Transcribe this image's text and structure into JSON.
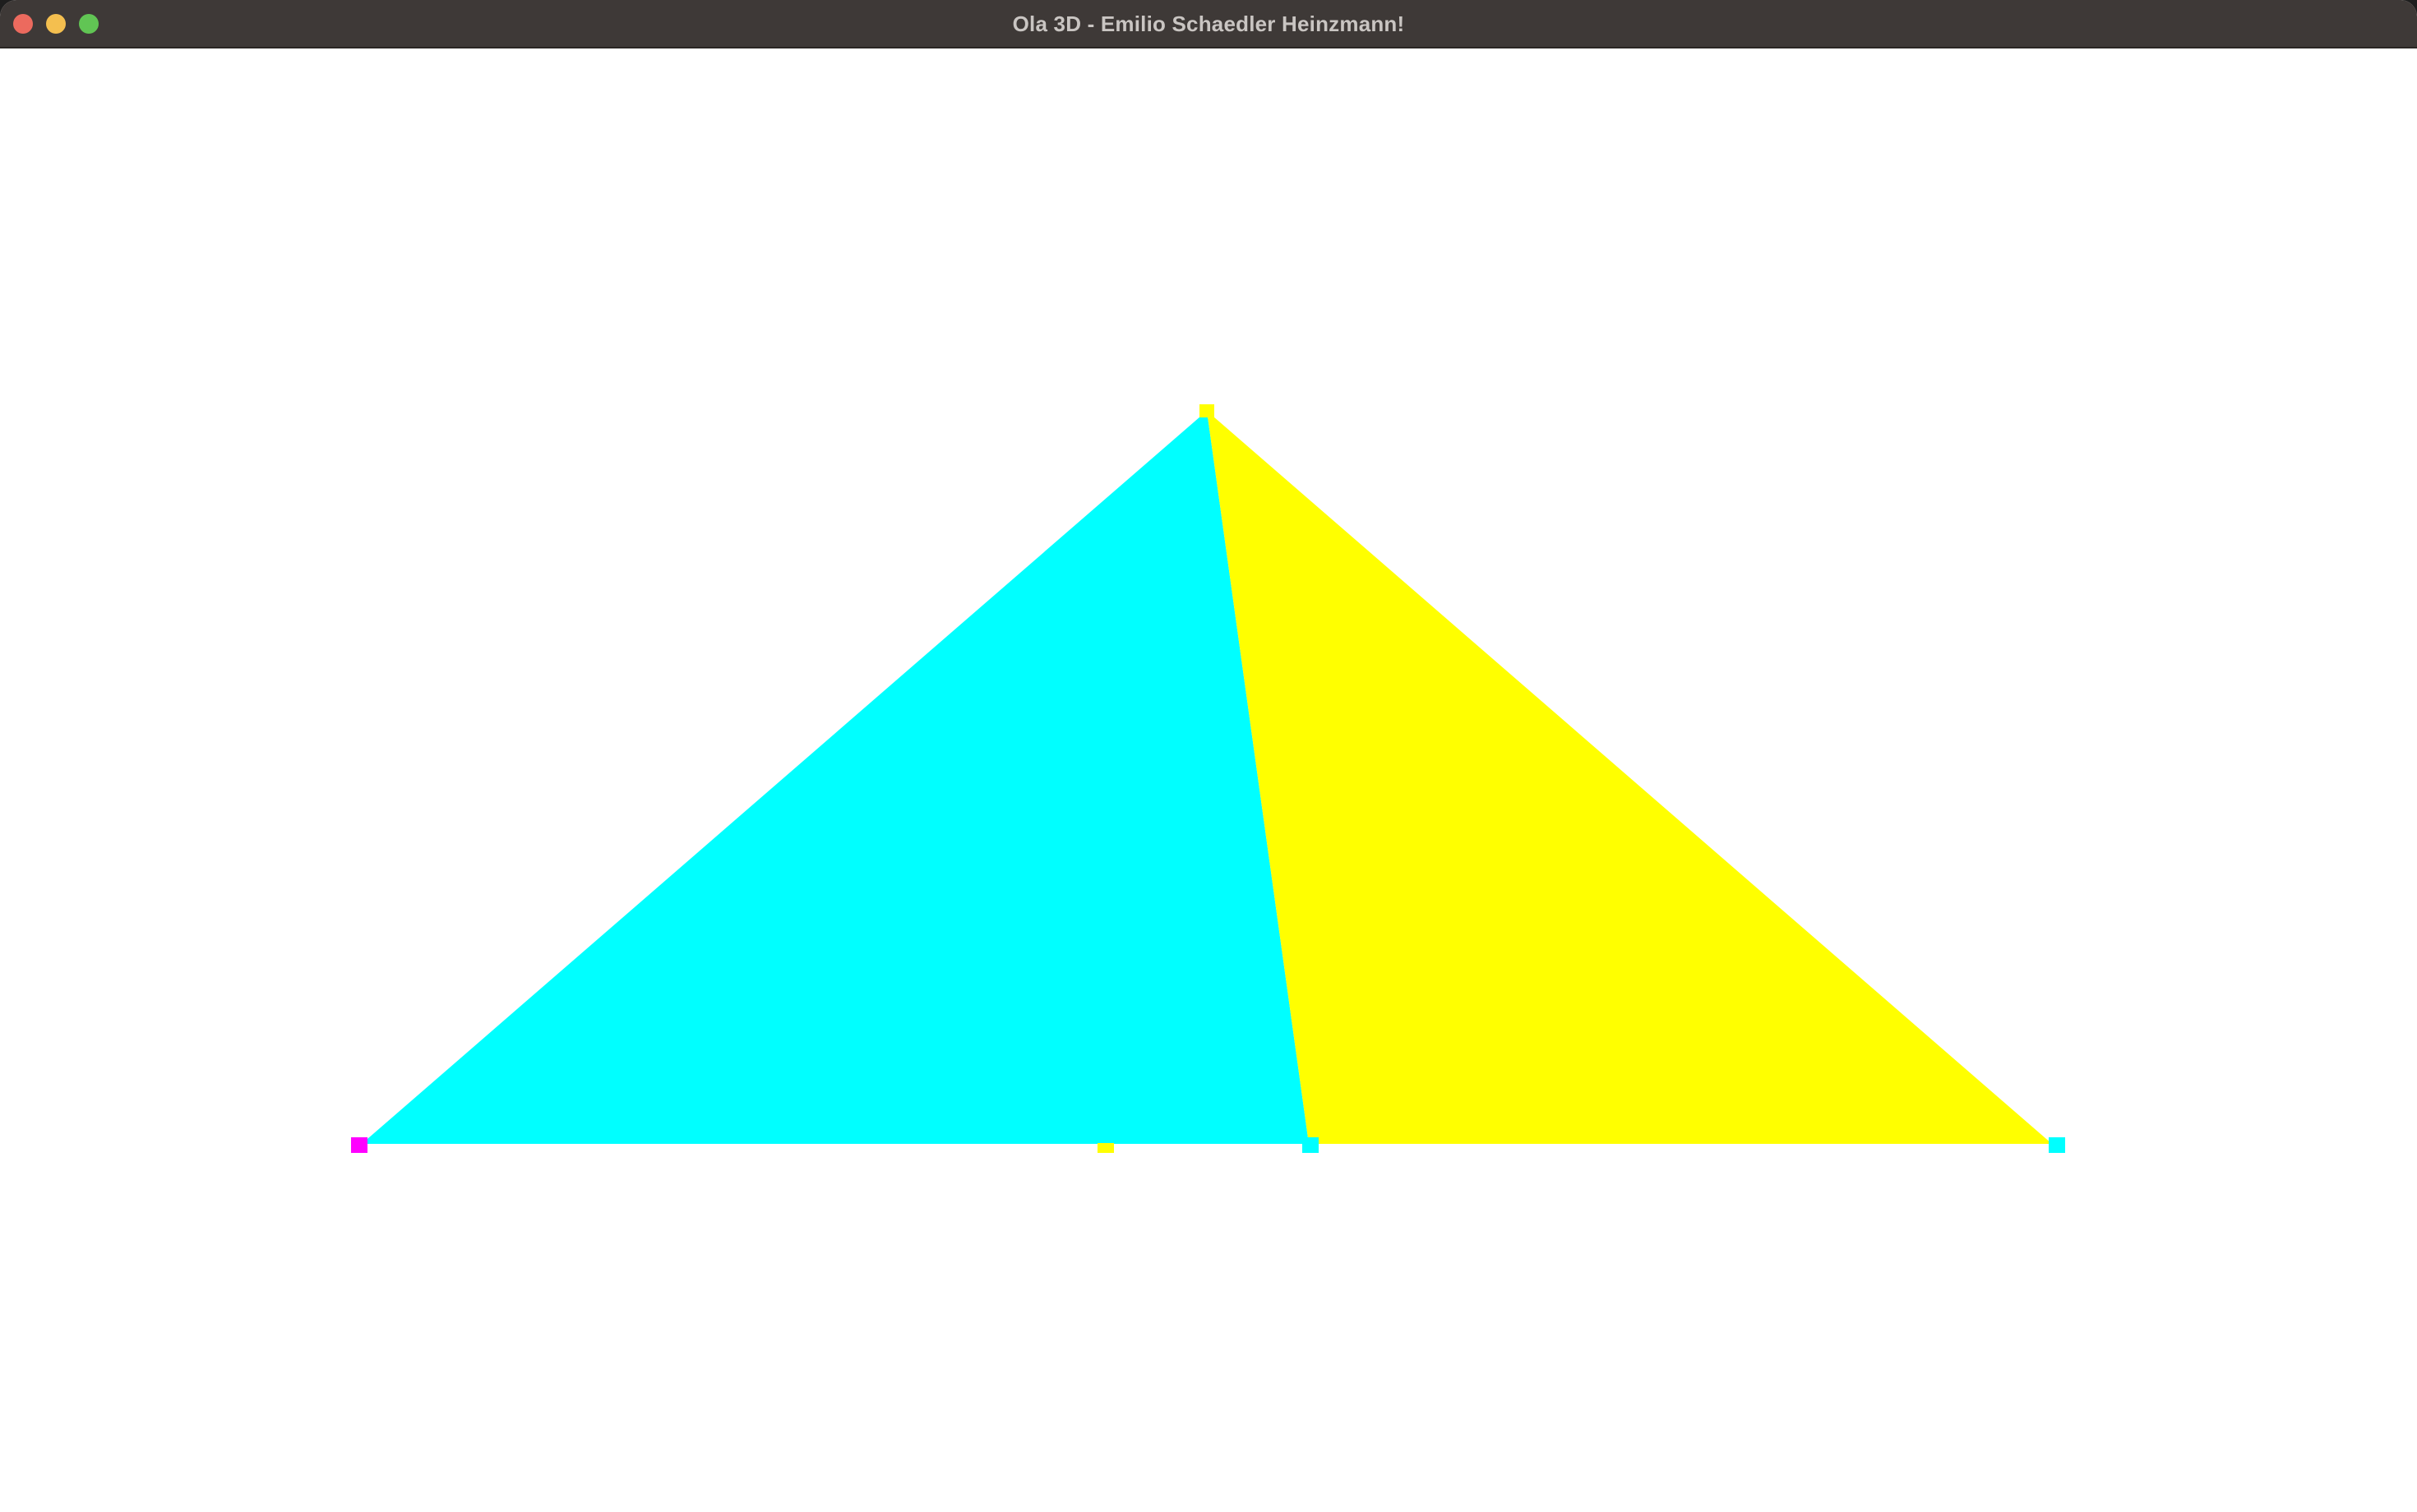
{
  "window": {
    "title": "Ola 3D - Emilio Schaedler Heinzmann!",
    "controls": {
      "close_color": "#ec6a5e",
      "minimize_color": "#f4bf4f",
      "zoom_color": "#61c554"
    }
  },
  "scene": {
    "background_color": "#ffffff",
    "triangles": [
      {
        "name": "cyan-triangle",
        "color": "#00ffff"
      },
      {
        "name": "yellow-triangle",
        "color": "#ffff00"
      }
    ],
    "vertex_markers": [
      {
        "name": "apex-marker",
        "color": "#ffff00"
      },
      {
        "name": "left-base-marker",
        "color": "#ff00ff"
      },
      {
        "name": "mid-base-marker",
        "color": "#ffff00"
      },
      {
        "name": "inner-base-marker",
        "color": "#00ffff"
      },
      {
        "name": "right-base-marker",
        "color": "#00ffff"
      }
    ]
  }
}
